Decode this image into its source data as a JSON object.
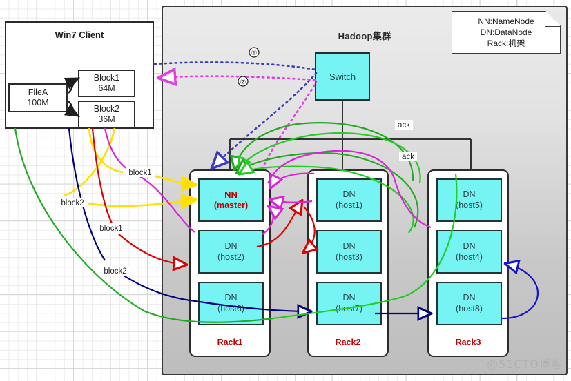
{
  "client": {
    "title": "Win7 Client",
    "file": {
      "name": "FileA",
      "size": "100M"
    },
    "blocks": [
      {
        "name": "Block1",
        "size": "64M"
      },
      {
        "name": "Block2",
        "size": "36M"
      }
    ]
  },
  "cluster": {
    "title": "Hadoop集群",
    "switch_label": "Switch"
  },
  "legend": {
    "lines": [
      "NN:NameNode",
      "DN:DataNode",
      "Rack:机架"
    ]
  },
  "racks": [
    {
      "label": "Rack1",
      "nodes": [
        {
          "main": "NN",
          "sub": "(master)",
          "master": true
        },
        {
          "main": "DN",
          "sub": "(host2)",
          "master": false
        },
        {
          "main": "DN",
          "sub": "(host6)",
          "master": false
        }
      ]
    },
    {
      "label": "Rack2",
      "nodes": [
        {
          "main": "DN",
          "sub": "(host1)",
          "master": false
        },
        {
          "main": "DN",
          "sub": "(host3)",
          "master": false
        },
        {
          "main": "DN",
          "sub": "(host7)",
          "master": false
        }
      ]
    },
    {
      "label": "Rack3",
      "nodes": [
        {
          "main": "DN",
          "sub": "(host5)",
          "master": false
        },
        {
          "main": "DN",
          "sub": "(host4)",
          "master": false
        },
        {
          "main": "DN",
          "sub": "(host8)",
          "master": false
        }
      ]
    }
  ],
  "edge_labels": {
    "step1": "①",
    "step2": "②",
    "block1_yellow": "block1",
    "block2_yellow": "block2",
    "block1_red": "block1",
    "block2_navy": "block2",
    "ack_upper": "ack",
    "ack_lower": "ack"
  },
  "colors": {
    "node_fill": "#76f3f3",
    "node_border": "#243434",
    "master_text": "#c00000",
    "rack_label": "#c00000",
    "cluster_bg_top": "#ebebeb",
    "cluster_bg_bottom": "#bdbdbd",
    "request_dotted": "#3b3bbf",
    "response_dotted": "#e040e0",
    "block1_arrow": "#ffe000",
    "block2_arrow": "#ffe000",
    "red_pipeline": "#e00000",
    "navy_pipeline": "#000080",
    "green_ack": "#22aa22",
    "bright_green": "#22cc22",
    "magenta_report": "#dd22dd",
    "blue_replicate": "#1515cc"
  },
  "watermark": "@51CTO博客"
}
